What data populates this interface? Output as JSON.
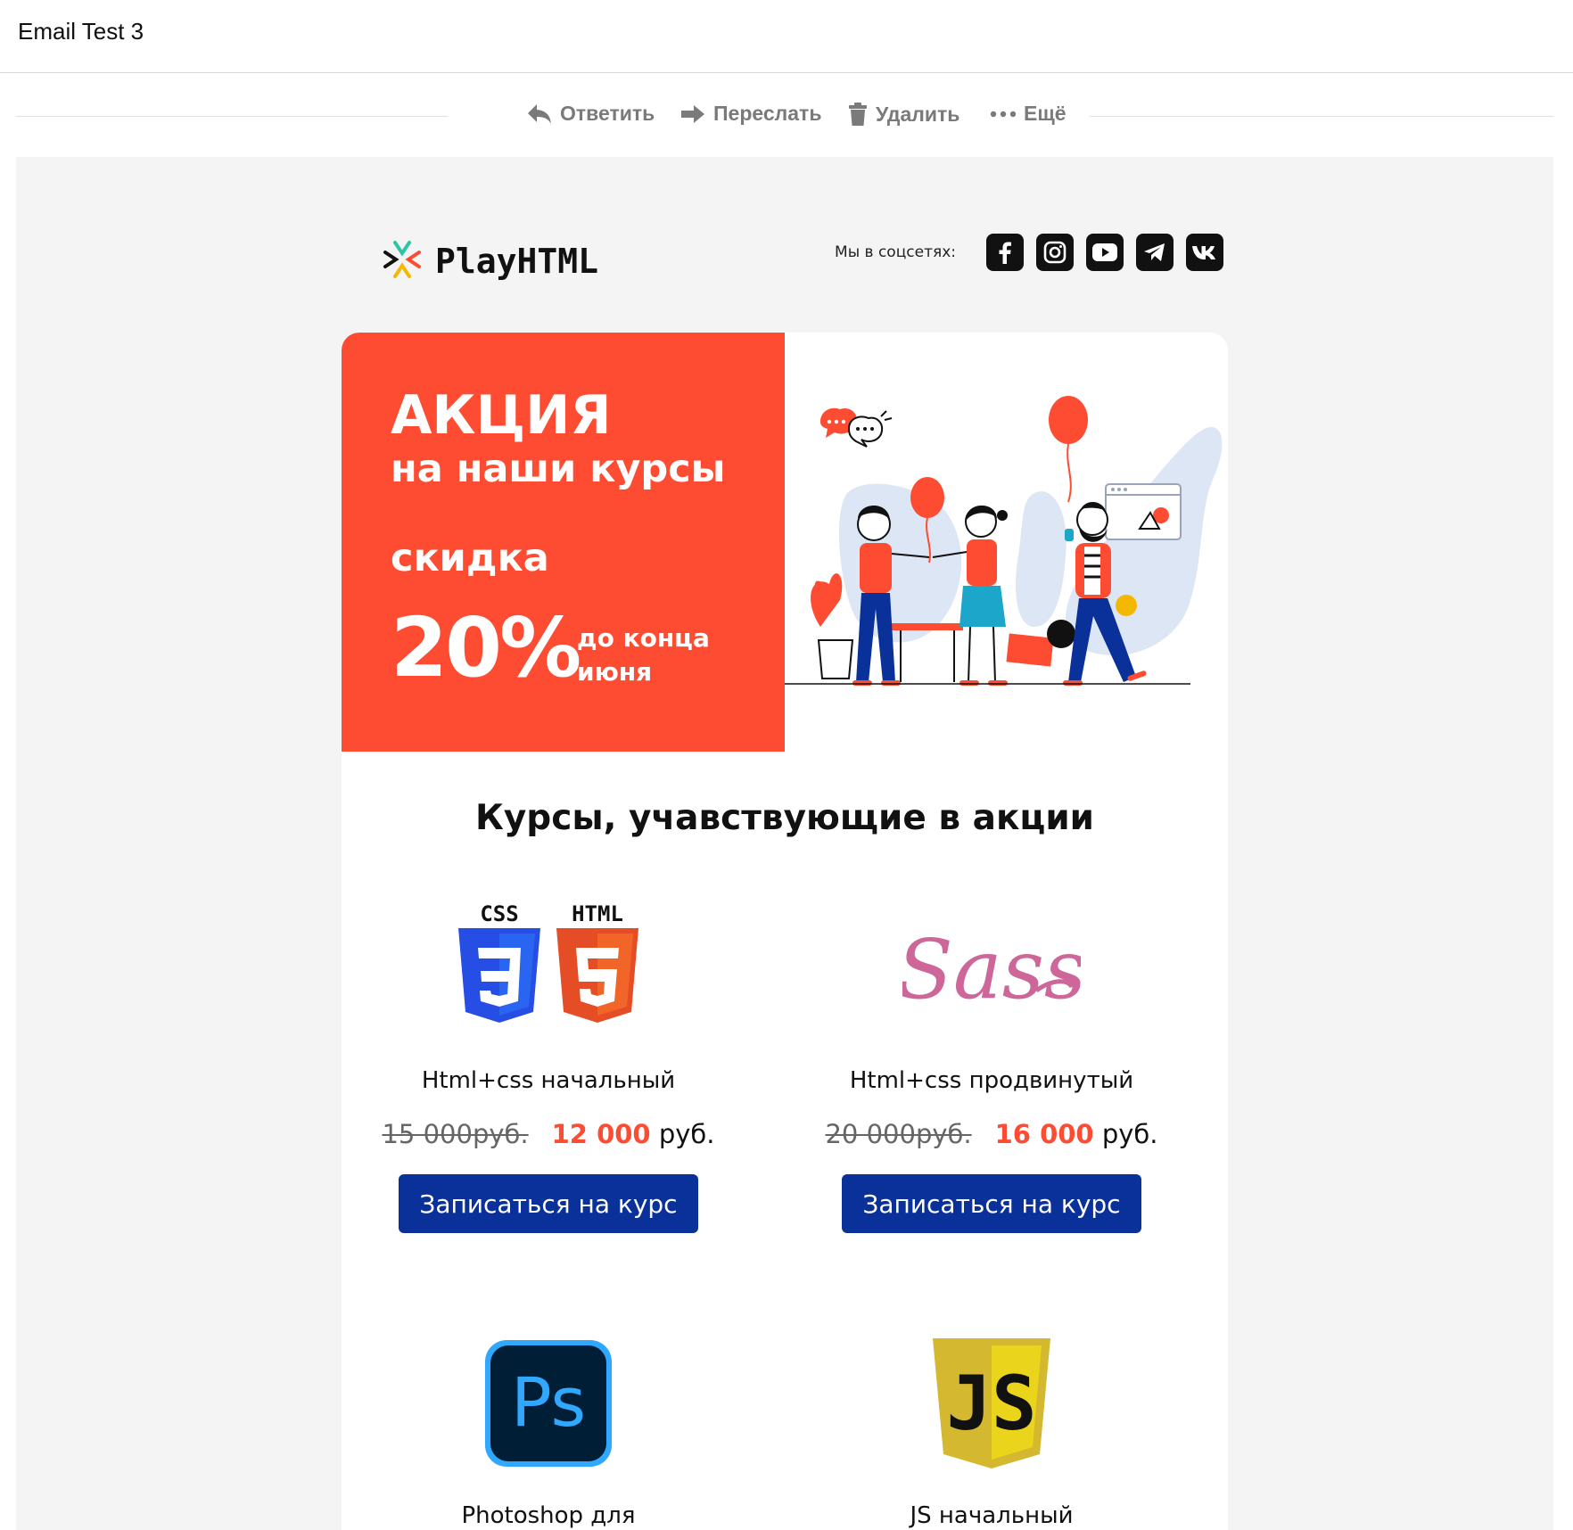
{
  "window": {
    "title": "Email Test 3"
  },
  "actions": {
    "reply": "Ответить",
    "forward": "Переслать",
    "delete": "Удалить",
    "more": "Ещё"
  },
  "header": {
    "brand": "PlayHTML",
    "social_label": "Мы в соцсетях:",
    "social": [
      "facebook-icon",
      "instagram-icon",
      "youtube-icon",
      "telegram-icon",
      "vk-icon"
    ]
  },
  "promo": {
    "title": "АКЦИЯ",
    "subtitle": "на наши курсы",
    "discount_label": "скидка",
    "discount_value": "20%",
    "deadline": "до конца июня",
    "accent_color": "#fe4c33"
  },
  "courses_section": {
    "title": "Курсы, учавствующие в акции",
    "courses": [
      {
        "name": "Html+css начальный",
        "old_price": "15 000руб.",
        "new_price": "12 000",
        "currency": "руб.",
        "button": "Записаться на курс",
        "logo": "css-html-logo"
      },
      {
        "name": "Html+css продвинутый",
        "old_price": "20 000руб.",
        "new_price": "16 000",
        "currency": "руб.",
        "button": "Записаться на курс",
        "logo": "sass-logo"
      },
      {
        "name": "Photoshop для верстальщика",
        "logo": "photoshop-logo"
      },
      {
        "name": "JS начальный",
        "logo": "js-logo"
      }
    ],
    "button_color": "#0a3199"
  },
  "logo_text": {
    "css": "CSS",
    "html": "HTML",
    "sass": "Sass",
    "ps": "Ps",
    "js": "JS"
  }
}
